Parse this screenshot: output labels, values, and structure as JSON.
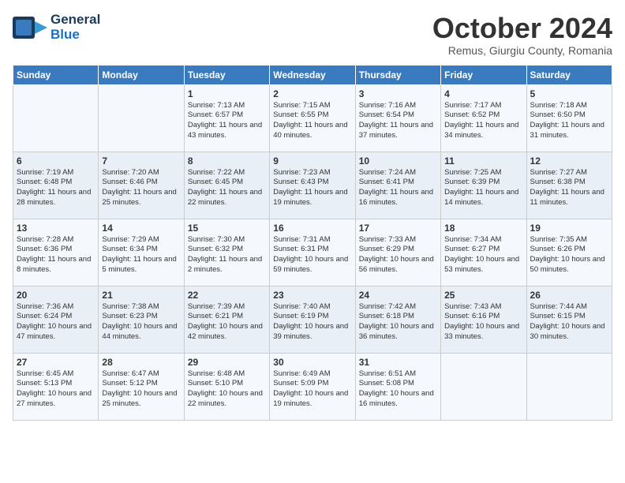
{
  "header": {
    "logo_line1": "General",
    "logo_line2": "Blue",
    "month": "October 2024",
    "location": "Remus, Giurgiu County, Romania"
  },
  "days_of_week": [
    "Sunday",
    "Monday",
    "Tuesday",
    "Wednesday",
    "Thursday",
    "Friday",
    "Saturday"
  ],
  "weeks": [
    [
      {
        "day": "",
        "content": ""
      },
      {
        "day": "",
        "content": ""
      },
      {
        "day": "1",
        "content": "Sunrise: 7:13 AM\nSunset: 6:57 PM\nDaylight: 11 hours and 43 minutes."
      },
      {
        "day": "2",
        "content": "Sunrise: 7:15 AM\nSunset: 6:55 PM\nDaylight: 11 hours and 40 minutes."
      },
      {
        "day": "3",
        "content": "Sunrise: 7:16 AM\nSunset: 6:54 PM\nDaylight: 11 hours and 37 minutes."
      },
      {
        "day": "4",
        "content": "Sunrise: 7:17 AM\nSunset: 6:52 PM\nDaylight: 11 hours and 34 minutes."
      },
      {
        "day": "5",
        "content": "Sunrise: 7:18 AM\nSunset: 6:50 PM\nDaylight: 11 hours and 31 minutes."
      }
    ],
    [
      {
        "day": "6",
        "content": "Sunrise: 7:19 AM\nSunset: 6:48 PM\nDaylight: 11 hours and 28 minutes."
      },
      {
        "day": "7",
        "content": "Sunrise: 7:20 AM\nSunset: 6:46 PM\nDaylight: 11 hours and 25 minutes."
      },
      {
        "day": "8",
        "content": "Sunrise: 7:22 AM\nSunset: 6:45 PM\nDaylight: 11 hours and 22 minutes."
      },
      {
        "day": "9",
        "content": "Sunrise: 7:23 AM\nSunset: 6:43 PM\nDaylight: 11 hours and 19 minutes."
      },
      {
        "day": "10",
        "content": "Sunrise: 7:24 AM\nSunset: 6:41 PM\nDaylight: 11 hours and 16 minutes."
      },
      {
        "day": "11",
        "content": "Sunrise: 7:25 AM\nSunset: 6:39 PM\nDaylight: 11 hours and 14 minutes."
      },
      {
        "day": "12",
        "content": "Sunrise: 7:27 AM\nSunset: 6:38 PM\nDaylight: 11 hours and 11 minutes."
      }
    ],
    [
      {
        "day": "13",
        "content": "Sunrise: 7:28 AM\nSunset: 6:36 PM\nDaylight: 11 hours and 8 minutes."
      },
      {
        "day": "14",
        "content": "Sunrise: 7:29 AM\nSunset: 6:34 PM\nDaylight: 11 hours and 5 minutes."
      },
      {
        "day": "15",
        "content": "Sunrise: 7:30 AM\nSunset: 6:32 PM\nDaylight: 11 hours and 2 minutes."
      },
      {
        "day": "16",
        "content": "Sunrise: 7:31 AM\nSunset: 6:31 PM\nDaylight: 10 hours and 59 minutes."
      },
      {
        "day": "17",
        "content": "Sunrise: 7:33 AM\nSunset: 6:29 PM\nDaylight: 10 hours and 56 minutes."
      },
      {
        "day": "18",
        "content": "Sunrise: 7:34 AM\nSunset: 6:27 PM\nDaylight: 10 hours and 53 minutes."
      },
      {
        "day": "19",
        "content": "Sunrise: 7:35 AM\nSunset: 6:26 PM\nDaylight: 10 hours and 50 minutes."
      }
    ],
    [
      {
        "day": "20",
        "content": "Sunrise: 7:36 AM\nSunset: 6:24 PM\nDaylight: 10 hours and 47 minutes."
      },
      {
        "day": "21",
        "content": "Sunrise: 7:38 AM\nSunset: 6:23 PM\nDaylight: 10 hours and 44 minutes."
      },
      {
        "day": "22",
        "content": "Sunrise: 7:39 AM\nSunset: 6:21 PM\nDaylight: 10 hours and 42 minutes."
      },
      {
        "day": "23",
        "content": "Sunrise: 7:40 AM\nSunset: 6:19 PM\nDaylight: 10 hours and 39 minutes."
      },
      {
        "day": "24",
        "content": "Sunrise: 7:42 AM\nSunset: 6:18 PM\nDaylight: 10 hours and 36 minutes."
      },
      {
        "day": "25",
        "content": "Sunrise: 7:43 AM\nSunset: 6:16 PM\nDaylight: 10 hours and 33 minutes."
      },
      {
        "day": "26",
        "content": "Sunrise: 7:44 AM\nSunset: 6:15 PM\nDaylight: 10 hours and 30 minutes."
      }
    ],
    [
      {
        "day": "27",
        "content": "Sunrise: 6:45 AM\nSunset: 5:13 PM\nDaylight: 10 hours and 27 minutes."
      },
      {
        "day": "28",
        "content": "Sunrise: 6:47 AM\nSunset: 5:12 PM\nDaylight: 10 hours and 25 minutes."
      },
      {
        "day": "29",
        "content": "Sunrise: 6:48 AM\nSunset: 5:10 PM\nDaylight: 10 hours and 22 minutes."
      },
      {
        "day": "30",
        "content": "Sunrise: 6:49 AM\nSunset: 5:09 PM\nDaylight: 10 hours and 19 minutes."
      },
      {
        "day": "31",
        "content": "Sunrise: 6:51 AM\nSunset: 5:08 PM\nDaylight: 10 hours and 16 minutes."
      },
      {
        "day": "",
        "content": ""
      },
      {
        "day": "",
        "content": ""
      }
    ]
  ]
}
